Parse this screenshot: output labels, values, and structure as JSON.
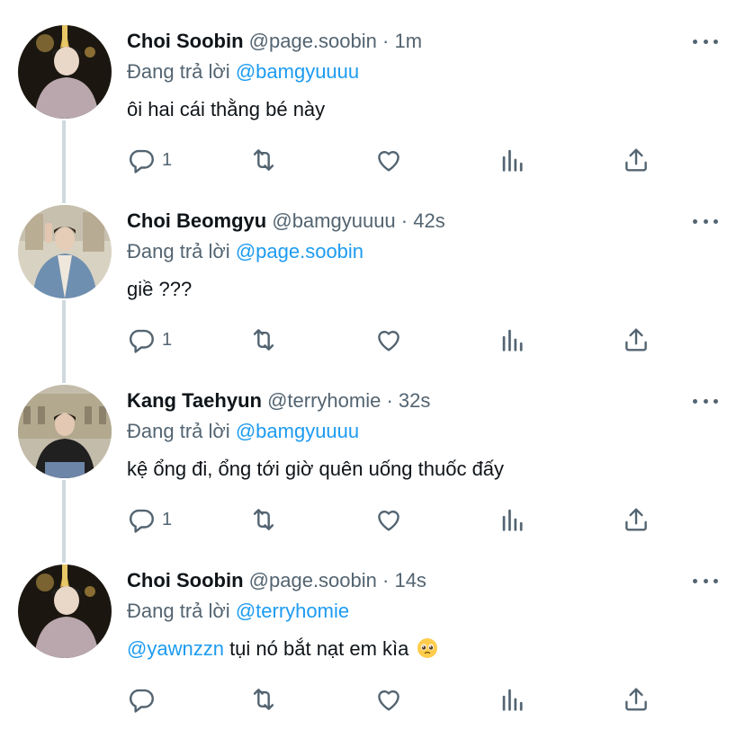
{
  "colors": {
    "text": "#0f1419",
    "secondary": "#536471",
    "accent": "#1d9bf0",
    "thread_line": "#cfd9de"
  },
  "tweets": [
    {
      "name": "Choi Soobin",
      "handle": "@page.soobin",
      "dot": "·",
      "time": "1m",
      "replying_prefix": "Đang trả lời",
      "replying_to": "@bamgyuuuu",
      "text": "ôi hai cái thằng bé này",
      "mention": "",
      "emoji": "",
      "reply_count": "1"
    },
    {
      "name": "Choi Beomgyu",
      "handle": "@bamgyuuuu",
      "dot": "·",
      "time": "42s",
      "replying_prefix": "Đang trả lời",
      "replying_to": "@page.soobin",
      "text": "giề ???",
      "mention": "",
      "emoji": "",
      "reply_count": "1"
    },
    {
      "name": "Kang Taehyun",
      "handle": "@terryhomie",
      "dot": "·",
      "time": "32s",
      "replying_prefix": "Đang trả lời",
      "replying_to": "@bamgyuuuu",
      "text": "kệ ổng đi, ổng tới giờ quên uống thuốc đấy",
      "mention": "",
      "emoji": "",
      "reply_count": "1"
    },
    {
      "name": "Choi Soobin",
      "handle": "@page.soobin",
      "dot": "·",
      "time": "14s",
      "replying_prefix": "Đang trả lời",
      "replying_to": "@terryhomie",
      "text": "tụi nó bắt nạt em kìa",
      "mention": "@yawnzzn",
      "emoji": "pleading-face-emoji",
      "reply_count": ""
    }
  ],
  "icons": {
    "reply": "reply-icon",
    "retweet": "retweet-icon",
    "like": "heart-icon",
    "views": "analytics-icon",
    "share": "share-icon",
    "more": "more-icon"
  }
}
